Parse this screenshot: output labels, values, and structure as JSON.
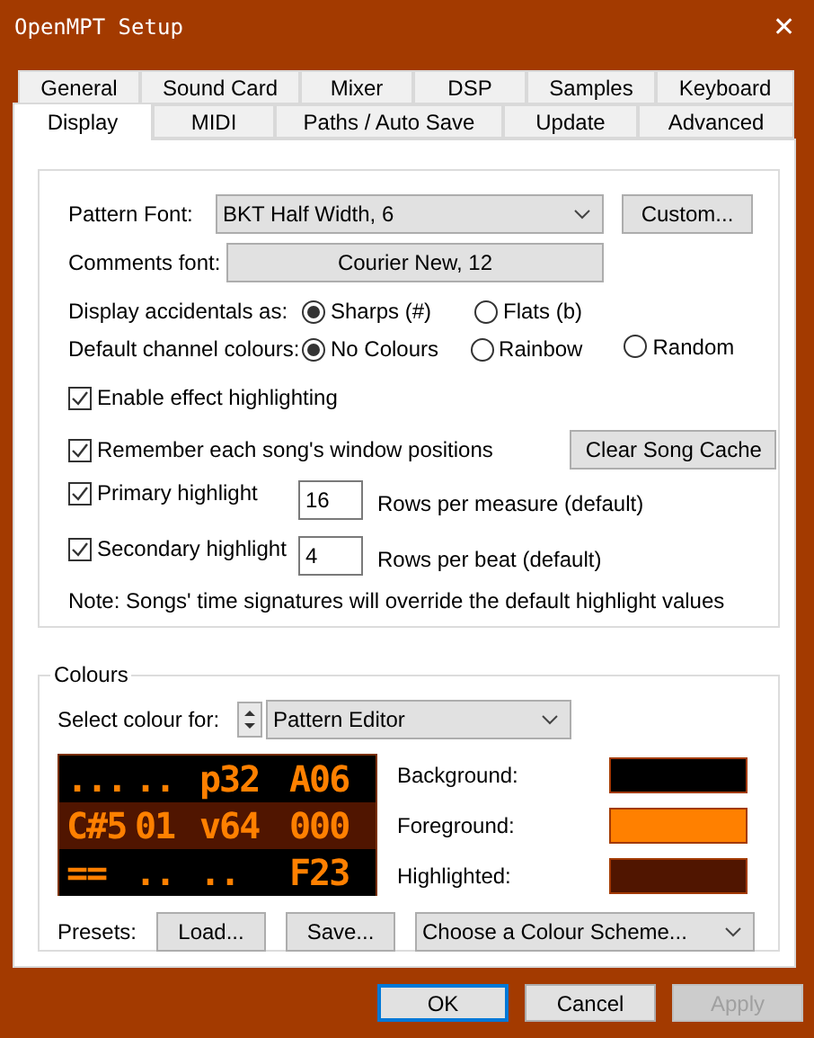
{
  "window": {
    "title": "OpenMPT Setup",
    "close": "✕"
  },
  "tab_rows": [
    [
      {
        "label": "General",
        "selected": false
      },
      {
        "label": "Sound Card",
        "selected": false
      },
      {
        "label": "Mixer",
        "selected": false
      },
      {
        "label": "DSP",
        "selected": false
      },
      {
        "label": "Samples",
        "selected": false
      },
      {
        "label": "Keyboard",
        "selected": false
      }
    ],
    [
      {
        "label": "Display",
        "selected": true
      },
      {
        "label": "MIDI",
        "selected": false
      },
      {
        "label": "Paths / Auto Save",
        "selected": false
      },
      {
        "label": "Update",
        "selected": false
      },
      {
        "label": "Advanced",
        "selected": false
      }
    ]
  ],
  "pattern_font": {
    "label": "Pattern Font:",
    "value": "BKT Half Width, 6",
    "button": "Custom..."
  },
  "comments_font": {
    "label": "Comments font:",
    "value": "Courier New, 12"
  },
  "accidentals": {
    "label": "Display accidentals as:",
    "options": [
      {
        "label": "Sharps (#)",
        "selected": true
      },
      {
        "label": "Flats (b)",
        "selected": false
      }
    ]
  },
  "channel_colours": {
    "label": "Default channel colours:",
    "options": [
      {
        "label": "No Colours",
        "selected": true
      },
      {
        "label": "Rainbow",
        "selected": false
      },
      {
        "label": "Random",
        "selected": false
      }
    ]
  },
  "effect_highlighting": {
    "label": "Enable effect highlighting",
    "checked": true
  },
  "remember_positions": {
    "label": "Remember each song's window positions",
    "checked": true,
    "button": "Clear Song Cache"
  },
  "highlights": [
    {
      "label": "Primary highlight",
      "checked": true,
      "value": "16",
      "description": "Rows per measure (default)"
    },
    {
      "label": "Secondary highlight",
      "checked": true,
      "value": "4",
      "description": "Rows per beat (default)"
    }
  ],
  "note": "Note: Songs' time signatures will override the default highlight values",
  "colours": {
    "title": "Colours",
    "select_label": "Select colour for:",
    "select_value": "Pattern Editor",
    "preview_rows": [
      {
        "highlighted": false,
        "cells": [
          "...",
          "..",
          "p32",
          "A06"
        ]
      },
      {
        "highlighted": true,
        "cells": [
          "C#5",
          "01",
          "v64",
          "000"
        ]
      },
      {
        "highlighted": false,
        "cells": [
          "==",
          "..",
          "..",
          "F23"
        ]
      }
    ],
    "swatches": [
      {
        "label": "Background:",
        "color": "#000000"
      },
      {
        "label": "Foreground:",
        "color": "#ff8000"
      },
      {
        "label": "Highlighted:",
        "color": "#501500"
      }
    ],
    "presets_label": "Presets:",
    "load": "Load...",
    "save": "Save...",
    "scheme": "Choose a Colour Scheme..."
  },
  "buttons": [
    {
      "label": "OK",
      "default": true,
      "disabled": false
    },
    {
      "label": "Cancel",
      "default": false,
      "disabled": false
    },
    {
      "label": "Apply",
      "default": false,
      "disabled": true
    }
  ]
}
